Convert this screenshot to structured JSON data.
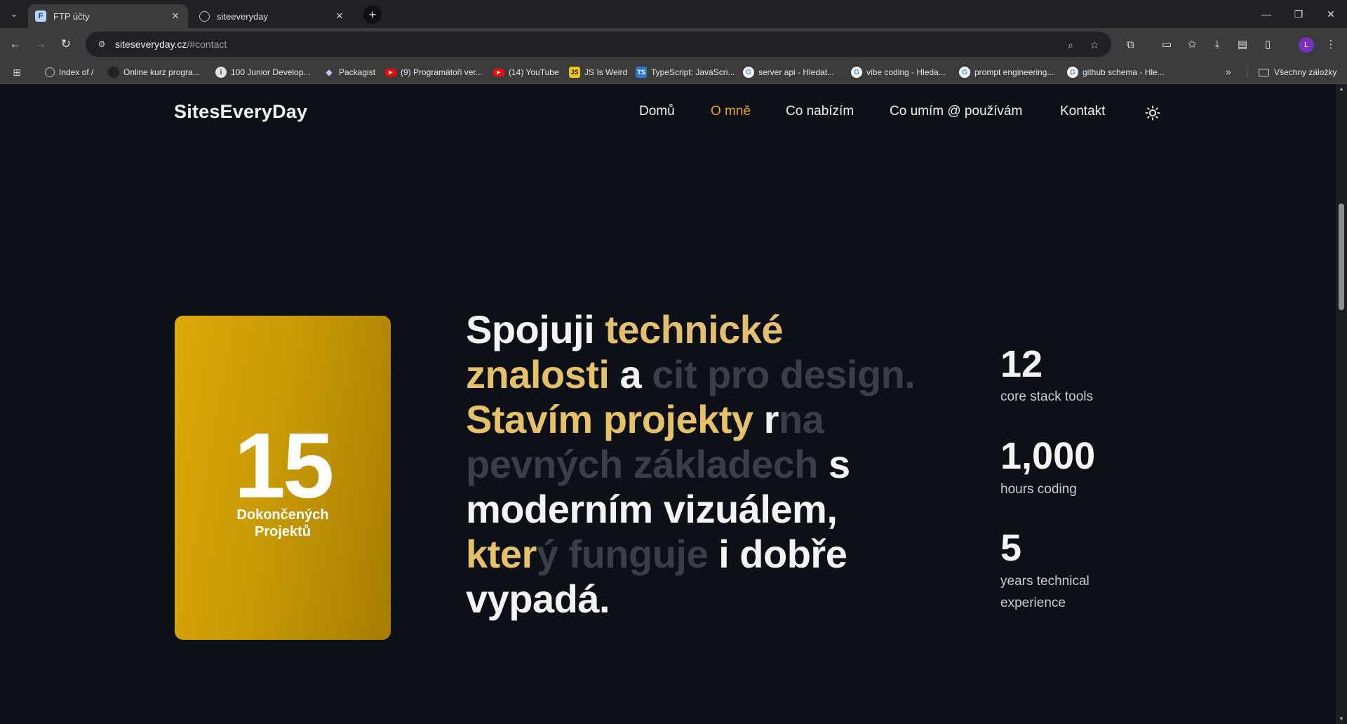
{
  "browser": {
    "tabs": [
      {
        "title": "FTP účty",
        "active": true
      },
      {
        "title": "siteeveryday",
        "active": false
      }
    ],
    "url_host": "siteseveryday.cz",
    "url_path": "/#contact",
    "bookmarks": [
      {
        "label": "Index of /",
        "icon": "globe-icon"
      },
      {
        "label": "Online kurz progra...",
        "icon": "github-icon"
      },
      {
        "label": "100 Junior Develop...",
        "icon": "info-icon"
      },
      {
        "label": "Packagist",
        "icon": "packagist-icon"
      },
      {
        "label": "(9) Programátoři ver...",
        "icon": "youtube-icon"
      },
      {
        "label": "(14) YouTube",
        "icon": "youtube-icon"
      },
      {
        "label": "JS Is Weird",
        "icon": "js-icon"
      },
      {
        "label": "TypeScript: JavaScri...",
        "icon": "ts-icon"
      },
      {
        "label": "server api - Hledat...",
        "icon": "google-icon"
      },
      {
        "label": "vibe coding - Hleda...",
        "icon": "google-icon"
      },
      {
        "label": "prompt engineering...",
        "icon": "google-icon"
      },
      {
        "label": "github schema - Hle...",
        "icon": "google-icon"
      }
    ],
    "bookmarks_folder": "Všechny záložky",
    "profile_initial": "L"
  },
  "site": {
    "logo": "SitesEveryDay",
    "nav": [
      {
        "label": "Domů",
        "active": false
      },
      {
        "label": "O mně",
        "active": true
      },
      {
        "label": "Co nabízím",
        "active": false
      },
      {
        "label": "Co umím @ používám",
        "active": false
      },
      {
        "label": "Kontakt",
        "active": false
      }
    ],
    "accent_color": "#e8a317"
  },
  "hero": {
    "card": {
      "number": "15",
      "label_line1": "Dokončených",
      "label_line2": "Projektů"
    },
    "headline": {
      "l1a": "Spojuji ",
      "l1b": "technické",
      "l2a": "znalosti",
      "l2b": " a ",
      "l2c": "cit pro design.",
      "l3a": "Stavím projekty ",
      "l3b": "r",
      "l3c": "na",
      "l4a": "pevných základech",
      "l4b": " s",
      "l5": "moderním vizuálem,",
      "l6a": "kter",
      "l6b": "ý funguje",
      "l6c": " i dobře",
      "l7": "vypadá."
    },
    "stats": [
      {
        "value": "12",
        "label": "core stack tools"
      },
      {
        "value": "1,000",
        "label": "hours coding"
      },
      {
        "value": "5",
        "label": "years technical experience"
      }
    ]
  }
}
